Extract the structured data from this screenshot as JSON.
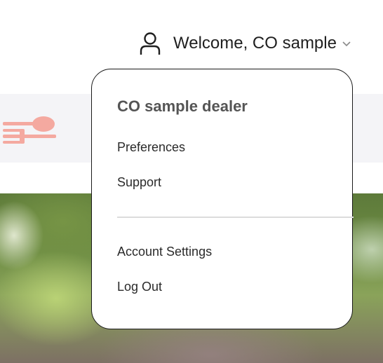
{
  "header": {
    "welcome_text": "Welcome, CO sample",
    "user_icon": "user-icon",
    "chevron_icon": "chevron-down-icon"
  },
  "brand": {
    "logo_icon": "utensils-logo-icon",
    "logo_color": "#f4a9a0"
  },
  "dropdown": {
    "dealer_name": "CO sample dealer",
    "items": [
      {
        "label": "Preferences"
      },
      {
        "label": "Support"
      }
    ],
    "account_items": [
      {
        "label": "Account Settings"
      },
      {
        "label": "Log Out"
      }
    ]
  }
}
